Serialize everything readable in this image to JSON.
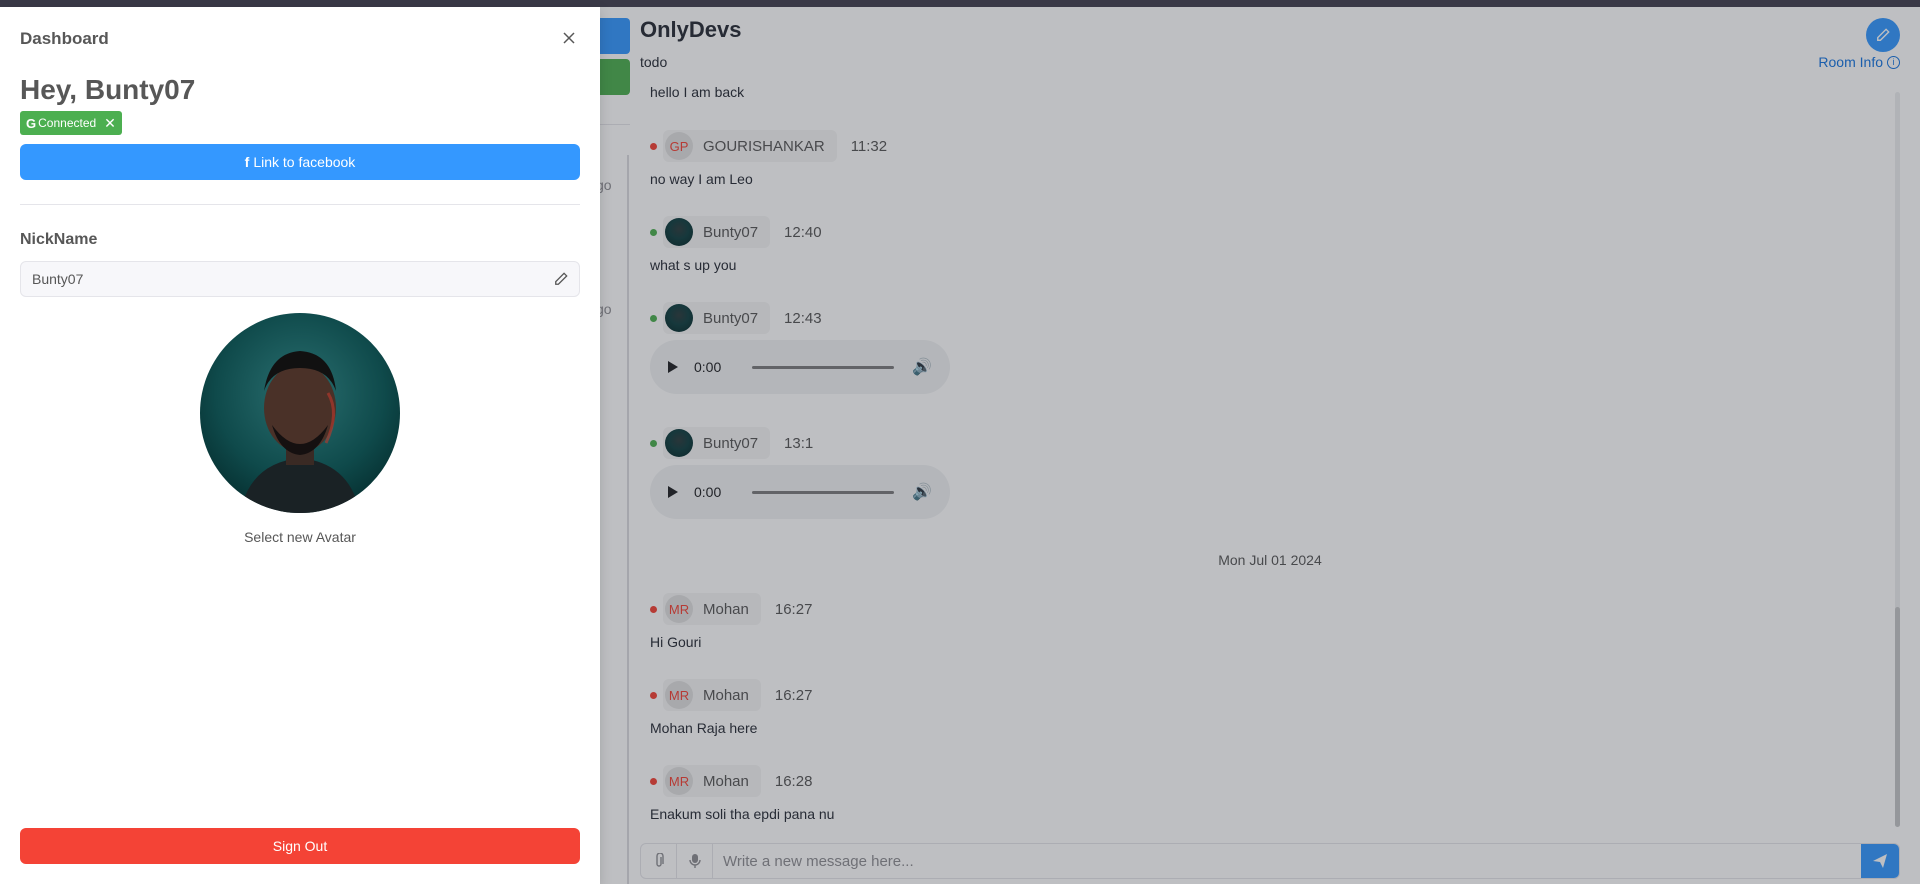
{
  "colors": {
    "primary": "#3498ff",
    "success": "#4caf50",
    "danger": "#f44336",
    "topbar": "#433f4f"
  },
  "sidebar": {
    "ago_1": "go",
    "ago_2": "go"
  },
  "room": {
    "title": "OnlyDevs",
    "description": "todo",
    "info_label": "Room Info",
    "info_icon": "info-icon",
    "edit_icon": "pencil-icon"
  },
  "messages": {
    "partial_text": "hello I am back",
    "items": [
      {
        "initials": "GP",
        "name": "GOURISHANKAR",
        "time": "11:32",
        "text": "no way I am Leo",
        "status": "offline"
      },
      {
        "initials": "",
        "name": "Bunty07",
        "time": "12:40",
        "text": "what s up you",
        "status": "online"
      },
      {
        "initials": "",
        "name": "Bunty07",
        "time": "12:43",
        "audio_time": "0:00",
        "status": "online"
      },
      {
        "initials": "",
        "name": "Bunty07",
        "time": "13:1",
        "audio_time": "0:00",
        "status": "online"
      },
      {
        "initials": "MR",
        "name": "Mohan",
        "time": "16:27",
        "text": "Hi Gouri",
        "status": "offline"
      },
      {
        "initials": "MR",
        "name": "Mohan",
        "time": "16:27",
        "text": "Mohan Raja here",
        "status": "offline"
      },
      {
        "initials": "MR",
        "name": "Mohan",
        "time": "16:28",
        "text": "Enakum soli tha epdi pana nu",
        "status": "offline"
      }
    ],
    "date_separator": "Mon Jul 01 2024"
  },
  "composer": {
    "placeholder": "Write a new message here...",
    "attach_icon": "paperclip-icon",
    "mic_icon": "microphone-icon",
    "send_icon": "send-icon"
  },
  "drawer": {
    "title": "Dashboard",
    "greeting": "Hey, Bunty07",
    "connected_tag": "Connected",
    "facebook_button": "Link to facebook",
    "nickname_label": "NickName",
    "nickname_value": "Bunty07",
    "select_avatar": "Select new Avatar",
    "sign_out": "Sign Out"
  }
}
